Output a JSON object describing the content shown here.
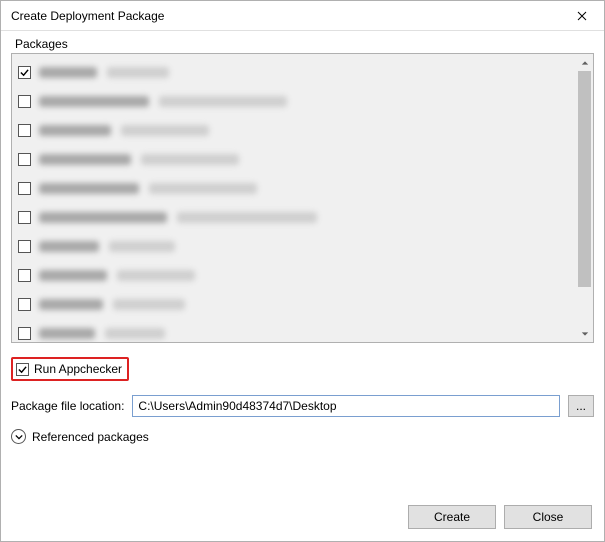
{
  "window": {
    "title": "Create Deployment Package"
  },
  "packages": {
    "label": "Packages",
    "items": [
      {
        "checked": true,
        "w1": 58,
        "w2": 62
      },
      {
        "checked": false,
        "w1": 110,
        "w2": 128
      },
      {
        "checked": false,
        "w1": 72,
        "w2": 88
      },
      {
        "checked": false,
        "w1": 92,
        "w2": 98
      },
      {
        "checked": false,
        "w1": 100,
        "w2": 108
      },
      {
        "checked": false,
        "w1": 128,
        "w2": 140
      },
      {
        "checked": false,
        "w1": 60,
        "w2": 66
      },
      {
        "checked": false,
        "w1": 68,
        "w2": 78
      },
      {
        "checked": false,
        "w1": 64,
        "w2": 72
      },
      {
        "checked": false,
        "w1": 56,
        "w2": 60
      }
    ]
  },
  "appchecker": {
    "label": "Run Appchecker",
    "checked": true
  },
  "location": {
    "label": "Package file location:",
    "value": "C:\\Users\\Admin90d48374d7\\Desktop",
    "browse": "..."
  },
  "referenced": {
    "label": "Referenced packages"
  },
  "buttons": {
    "create": "Create",
    "close": "Close"
  }
}
